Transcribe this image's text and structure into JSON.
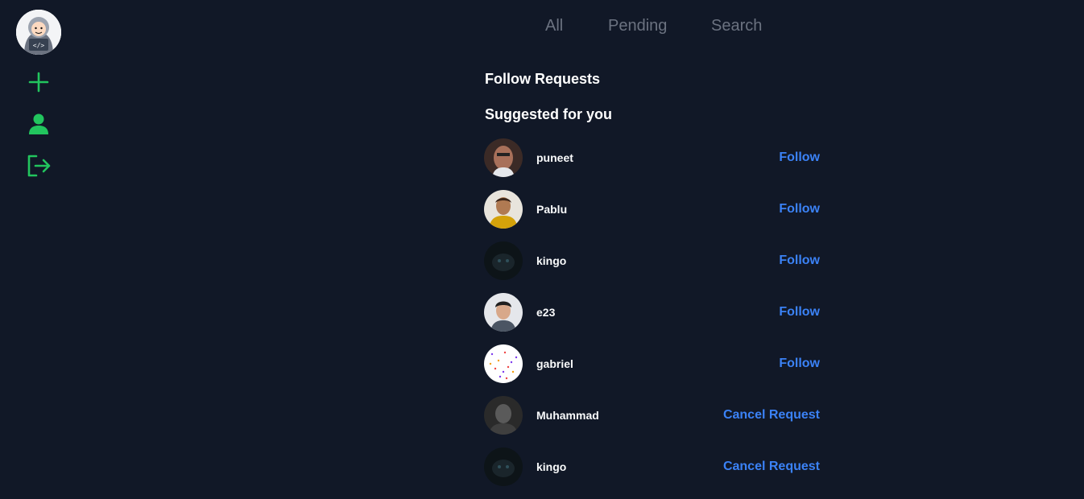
{
  "sidebar": {
    "items": [
      {
        "icon": "plus-icon"
      },
      {
        "icon": "user-icon"
      },
      {
        "icon": "logout-icon"
      }
    ],
    "accent": "#22c55e"
  },
  "tabs": [
    {
      "label": "All"
    },
    {
      "label": "Pending"
    },
    {
      "label": "Search"
    }
  ],
  "sections": {
    "follow_requests": "Follow Requests",
    "suggested": "Suggested for you"
  },
  "users": [
    {
      "name": "puneet",
      "action": "Follow"
    },
    {
      "name": "Pablu",
      "action": "Follow"
    },
    {
      "name": "kingo",
      "action": "Follow"
    },
    {
      "name": "e23",
      "action": "Follow"
    },
    {
      "name": "gabriel",
      "action": "Follow"
    },
    {
      "name": "Muhammad",
      "action": "Cancel Request"
    },
    {
      "name": "kingo",
      "action": "Cancel Request"
    }
  ],
  "colors": {
    "background": "#111827",
    "link": "#3b82f6",
    "tab": "#6b7280"
  }
}
